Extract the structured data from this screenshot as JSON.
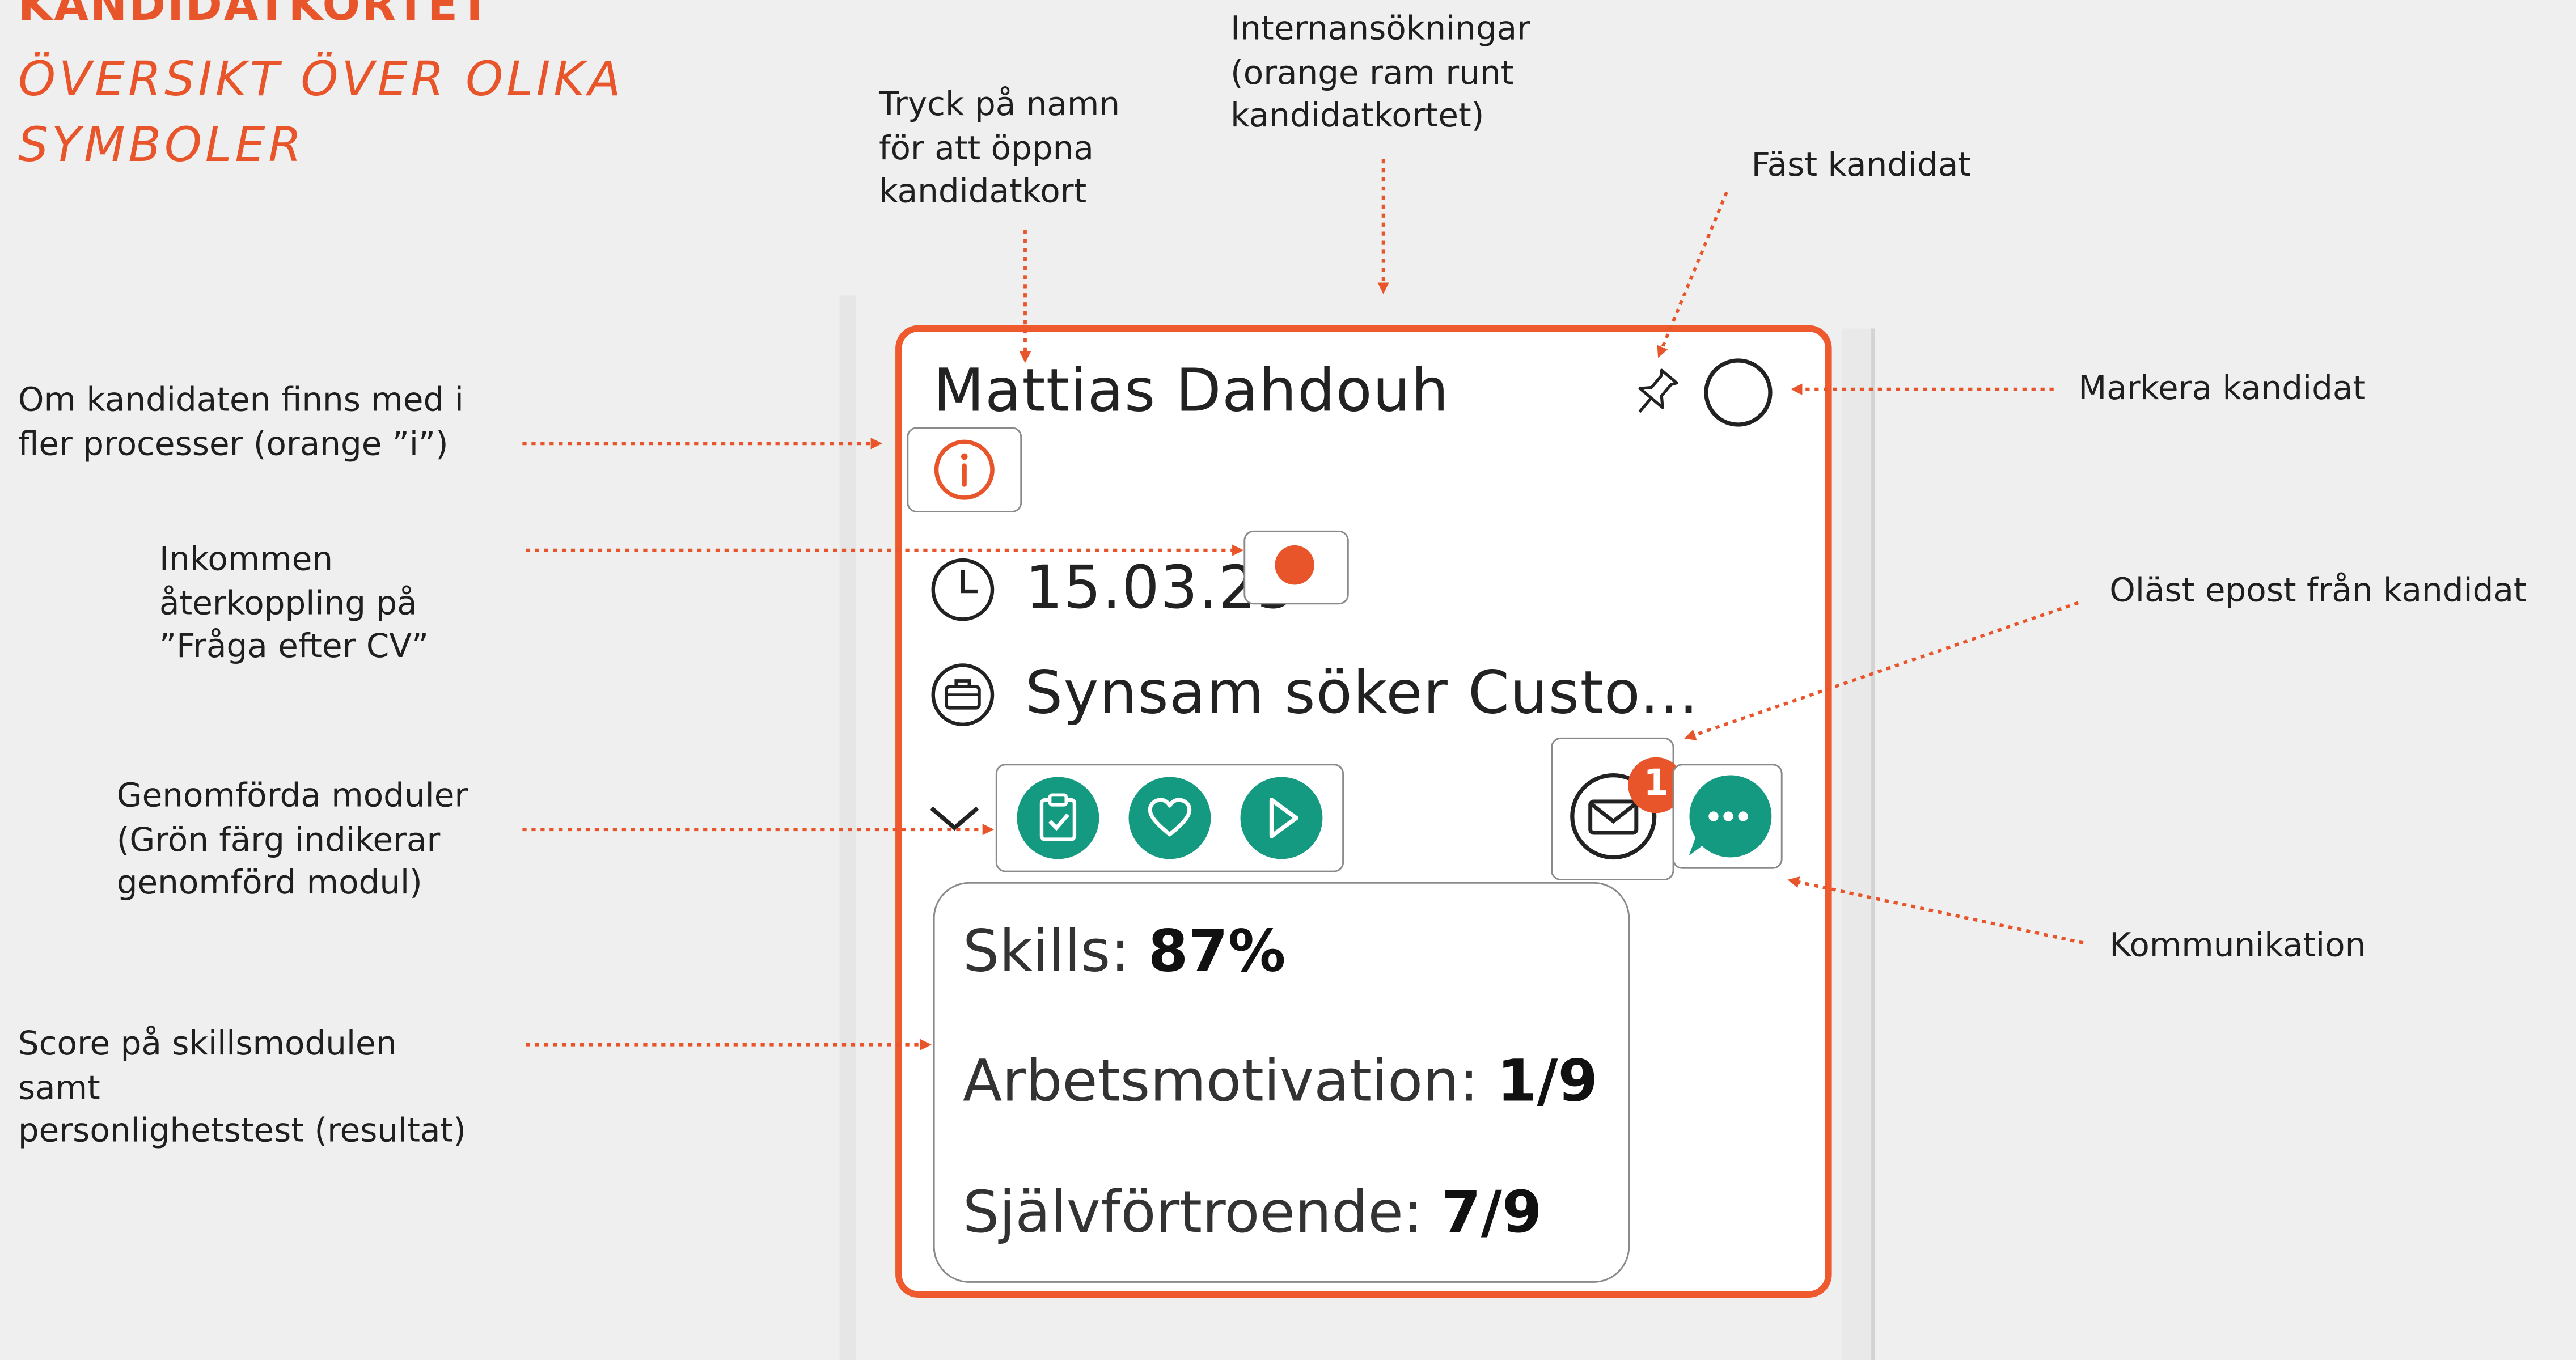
{
  "colors": {
    "accent": "#e8552a",
    "module_green": "#159a82",
    "background": "#efefef"
  },
  "header": {
    "title": "KANDIDATKORTET",
    "subtitle": "ÖVERSIKT ÖVER OLIKA SYMBOLER"
  },
  "annotations": {
    "open_card": "Tryck på namn\nför att öppna\nkandidatkort",
    "internal": "Internansökningar\n(orange ram runt\nkandidatkortet)",
    "pinned": "Fäst kandidat",
    "select": "Markera kandidat",
    "other_processes": "Om kandidaten finns med i\nfler processer (orange ”i”)",
    "feedback": "Inkommen\nåterkoppling på\n”Fråga efter CV”",
    "unread_email": "Oläst epost från kandidat",
    "modules": "Genomförda moduler\n(Grön färg indikerar\ngenomförd modul)",
    "communication": "Kommunikation",
    "score": "Score på skillsmodulen\nsamt\npersonlighetstest (resultat)"
  },
  "card": {
    "name": "Mattias Dahdouh",
    "date": "15.03.23",
    "job": "Synsam söker Custo...",
    "unread_count": "1",
    "icons": {
      "pin": "pin-icon",
      "select": "select-circle-icon",
      "info": "info-icon",
      "clock": "clock-icon",
      "briefcase": "briefcase-icon",
      "expand": "chevron-down-icon",
      "modules": [
        "clipboard-check-icon",
        "heart-icon",
        "play-icon"
      ],
      "mail": "mail-icon",
      "chat": "chat-icon"
    },
    "scores": [
      {
        "label": "Skills: ",
        "value": "87%"
      },
      {
        "label": "Arbetsmotivation: ",
        "value": "1/9"
      },
      {
        "label": "Självförtroende: ",
        "value": "7/9"
      }
    ]
  }
}
